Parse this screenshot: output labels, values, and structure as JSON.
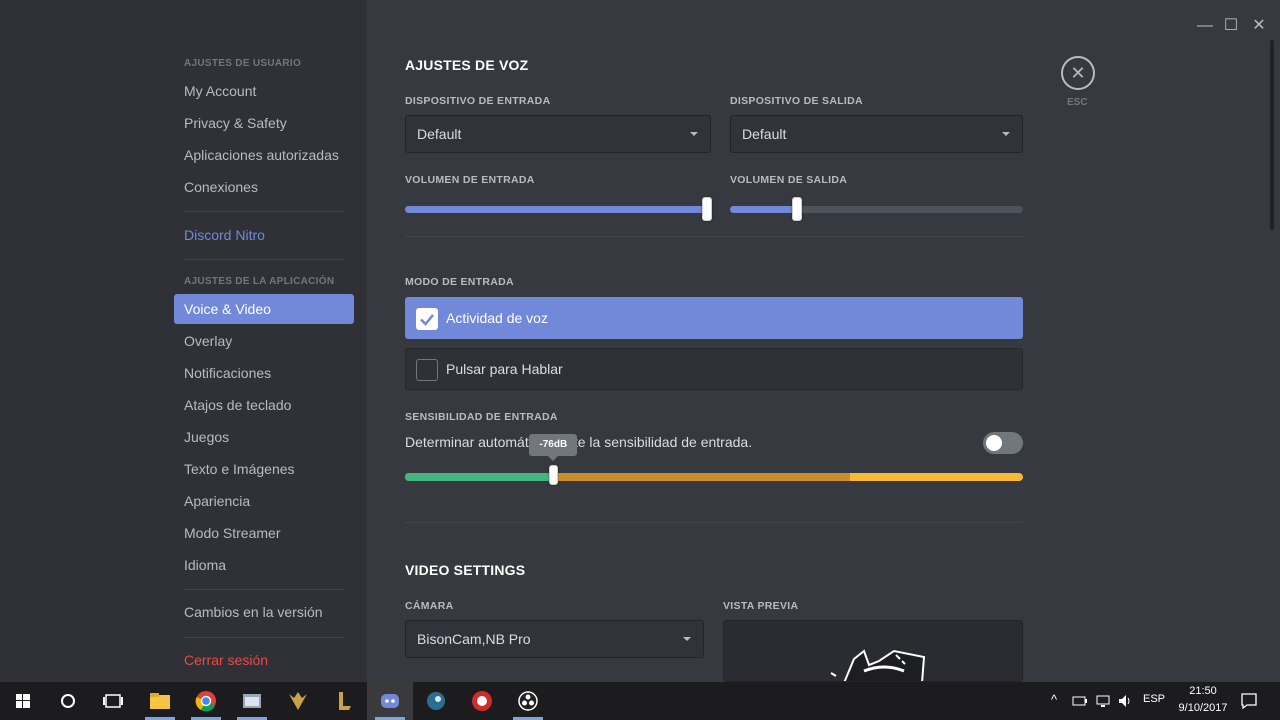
{
  "window": {
    "minimize_glyph": "—",
    "maximize_glyph": "☐",
    "close_glyph": "✕"
  },
  "sidebar": {
    "user_header": "AJUSTES DE USUARIO",
    "user_items": [
      "My Account",
      "Privacy & Safety",
      "Aplicaciones autorizadas",
      "Conexiones"
    ],
    "nitro": "Discord Nitro",
    "app_header": "AJUSTES DE LA APLICACIÓN",
    "app_items": [
      "Voice & Video",
      "Overlay",
      "Notificaciones",
      "Atajos de teclado",
      "Juegos",
      "Texto e Imágenes",
      "Apariencia",
      "Modo Streamer",
      "Idioma"
    ],
    "active_item": "Voice & Video",
    "changelog": "Cambios en la versión",
    "logout": "Cerrar sesión"
  },
  "voice": {
    "title": "AJUSTES DE VOZ",
    "input_device_label": "DISPOSITIVO DE ENTRADA",
    "input_device_value": "Default",
    "output_device_label": "DISPOSITIVO DE SALIDA",
    "output_device_value": "Default",
    "input_volume_label": "VOLUMEN DE ENTRADA",
    "input_volume_fraction": 1.0,
    "output_volume_label": "VOLUMEN DE SALIDA",
    "output_volume_fraction": 0.23,
    "input_mode_label": "MODO DE ENTRADA",
    "modes": [
      {
        "label": "Actividad de voz",
        "checked": true
      },
      {
        "label": "Pulsar para Hablar",
        "checked": false
      }
    ],
    "sensitivity_label": "SENSIBILIDAD DE ENTRADA",
    "auto_sensitivity_text": "Determinar automáticamente la sensibilidad de entrada.",
    "auto_sensitivity_enabled": false,
    "sensitivity_tooltip": "-76dB",
    "sensitivity_fraction": 0.24
  },
  "video": {
    "title": "VIDEO SETTINGS",
    "camera_label": "CÁMARA",
    "camera_value": "BisonCam,NB Pro",
    "preview_label": "VISTA PREVIA"
  },
  "close": {
    "glyph": "✕",
    "label": "ESC"
  },
  "taskbar": {
    "language": "ESP",
    "time": "21:50",
    "date": "9/10/2017"
  },
  "colors": {
    "accent": "#7289da",
    "green": "#43b581",
    "amber": "#faa61a",
    "danger": "#f04747"
  }
}
